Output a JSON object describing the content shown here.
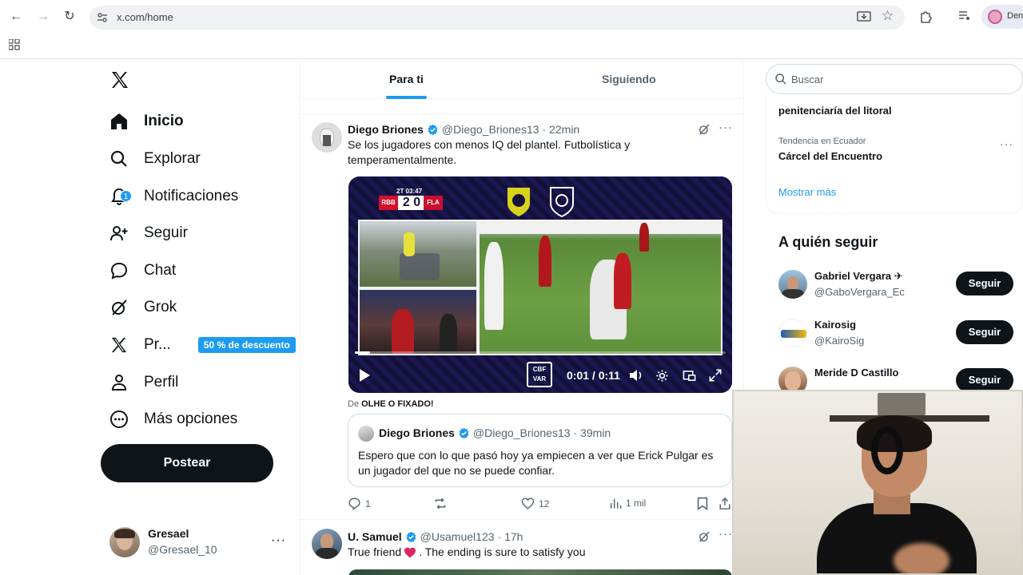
{
  "browser": {
    "url": "x.com/home",
    "profile_label": "Den"
  },
  "nav": {
    "items": [
      {
        "label": "Inicio",
        "icon": "home-icon"
      },
      {
        "label": "Explorar",
        "icon": "search-icon"
      },
      {
        "label": "Notificaciones",
        "icon": "bell-icon",
        "badge": "1"
      },
      {
        "label": "Seguir",
        "icon": "person-add-icon"
      },
      {
        "label": "Chat",
        "icon": "chat-bubble-icon"
      },
      {
        "label": "Grok",
        "icon": "grok-icon"
      },
      {
        "label": "Pr...",
        "icon": "x-premium-icon",
        "promo": "50 % de descuento"
      },
      {
        "label": "Perfil",
        "icon": "person-icon"
      },
      {
        "label": "Más opciones",
        "icon": "more-circle-icon"
      }
    ],
    "post_button": "Postear",
    "account": {
      "name": "Gresael",
      "handle": "@Gresael_10"
    }
  },
  "tabs": [
    {
      "label": "Para ti",
      "active": true
    },
    {
      "label": "Siguiendo",
      "active": false
    }
  ],
  "tweet1": {
    "name": "Diego Briones",
    "handle": "@Diego_Briones13",
    "time": "· 22min",
    "text": "Se los jugadores con menos IQ del plantel. Futbolística y temperamentalmente.",
    "video": {
      "clock": "2T 03:47",
      "team_home": "RBB",
      "score": "2 0",
      "team_away": "FLA",
      "overlay": "CBF VAR",
      "time": "0:01 / 0:11",
      "progress": 0.04
    },
    "from_prefix": "De",
    "from_source": "OLHE O FIXADO!",
    "quote": {
      "name": "Diego Briones",
      "handle": "@Diego_Briones13",
      "time": "· 39min",
      "text": "Espero que con lo que pasó hoy ya empiecen a ver que Erick Pulgar es un jugador del que no se puede confiar."
    },
    "actions": {
      "replies": "1",
      "likes": "12",
      "views": "1 mil"
    }
  },
  "tweet2": {
    "name": "U. Samuel",
    "handle": "@Usamuel123",
    "time": "· 17h",
    "text_before": "True friend",
    "text_after": ". The ending is sure to satisfy you"
  },
  "search": {
    "placeholder": "Buscar"
  },
  "trends": [
    {
      "context": "",
      "title": "penitenciaría del litoral"
    },
    {
      "context": "Tendencia en Ecuador",
      "title": "Cárcel del Encuentro"
    }
  ],
  "show_more": "Mostrar más",
  "who_to_follow": {
    "title": "A quién seguir",
    "accounts": [
      {
        "name": "Gabriel Vergara ✈",
        "handle": "@GaboVergara_Ec",
        "button": "Seguir"
      },
      {
        "name": "Kairosig",
        "handle": "@KairoSig",
        "button": "Seguir"
      },
      {
        "name": "Meride D Castillo",
        "handle": "",
        "button": "Seguir"
      }
    ]
  },
  "colors": {
    "accent": "#1d9bf0",
    "text": "#0f1419",
    "muted": "#536471",
    "like_heart": "#e0245e"
  }
}
